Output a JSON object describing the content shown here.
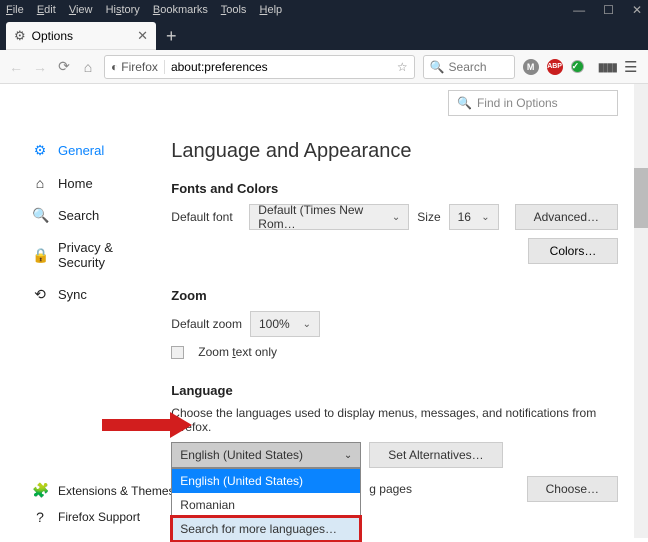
{
  "menubar": [
    "File",
    "Edit",
    "View",
    "History",
    "Bookmarks",
    "Tools",
    "Help"
  ],
  "tab": {
    "title": "Options"
  },
  "urlbar": {
    "prefix": "Firefox",
    "url": "about:preferences"
  },
  "searchbar_placeholder": "Search",
  "findbox_placeholder": "Find in Options",
  "sidebar": {
    "general": "General",
    "home": "Home",
    "search": "Search",
    "privacy": "Privacy & Security",
    "sync": "Sync",
    "ext": "Extensions & Themes",
    "support": "Firefox Support"
  },
  "section_title": "Language and Appearance",
  "fonts": {
    "heading": "Fonts and Colors",
    "default_label": "Default font",
    "default_value": "Default (Times New Rom…",
    "size_label": "Size",
    "size_value": "16",
    "advanced": "Advanced…",
    "colors": "Colors…"
  },
  "zoom": {
    "heading": "Zoom",
    "default_label": "Default zoom",
    "value": "100%",
    "textonly": "Zoom text only"
  },
  "language": {
    "heading": "Language",
    "desc": "Choose the languages used to display menus, messages, and notifications from Firefox.",
    "selected": "English (United States)",
    "set_alt": "Set Alternatives…",
    "opts": {
      "en": "English (United States)",
      "ro": "Romanian",
      "more": "Search for more languages…"
    },
    "pages_hint": "g pages",
    "choose": "Choose…"
  }
}
